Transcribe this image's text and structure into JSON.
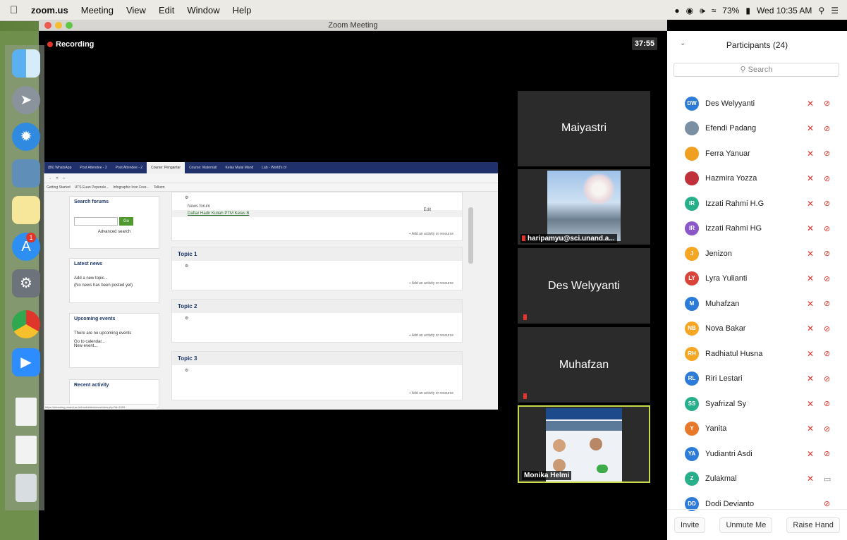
{
  "menubar": {
    "app_name": "zoom.us",
    "items": [
      "Meeting",
      "View",
      "Edit",
      "Window",
      "Help"
    ],
    "battery": "73%",
    "clock": "Wed 10:35 AM"
  },
  "window": {
    "title": "Zoom Meeting",
    "recording_label": "Recording",
    "timer": "37:55"
  },
  "shared_screen": {
    "tabs": [
      "(86) WhatsApp",
      "Post Attendee - 2",
      "Post Attendee - 2",
      "Course: Pengantar",
      "Course: Matemati",
      "Kelas Mulai Mand",
      "Lab - World's of"
    ],
    "active_tab_index": 3,
    "bookmarks": [
      "Getting Started",
      "UTS Euan Peperele...",
      "Infographic Icon Free...",
      "Telkom"
    ],
    "blocks": {
      "search_forums": {
        "title": "Search forums",
        "go": "Go",
        "advanced": "Advanced search"
      },
      "latest_news": {
        "title": "Latest news",
        "add": "Add a new topic...",
        "none": "(No news has been posted yet)"
      },
      "upcoming_events": {
        "title": "Upcoming events",
        "none": "There are no upcoming events",
        "go_calendar": "Go to calendar...",
        "new_event": "New event..."
      },
      "recent_activity": {
        "title": "Recent activity"
      }
    },
    "general": {
      "items": [
        "News forum",
        "Daftar Hadir Kuliah PTM Kelas B"
      ],
      "edit": "Edit",
      "add": "+ Add an activity or resource"
    },
    "topics": [
      {
        "title": "Topic 1",
        "add": "+ Add an activity or resource"
      },
      {
        "title": "Topic 2",
        "add": "+ Add an activity or resource"
      },
      {
        "title": "Topic 3",
        "add": "+ Add an activity or resource"
      }
    ],
    "status_url": "https://elearning.unand.ac.id/mod/attendance/view.php?id=1509"
  },
  "videos": [
    {
      "name": "Maiyastri",
      "muted": false
    },
    {
      "name": "haripamyu@sci.unand.a...",
      "muted": true
    },
    {
      "name": "Des Welyyanti",
      "muted": true
    },
    {
      "name": "Muhafzan",
      "muted": true
    },
    {
      "name": "Monika Helmi",
      "muted": false
    }
  ],
  "participants_panel": {
    "title": "Participants (24)",
    "search_placeholder": "Search",
    "participants": [
      {
        "name": "Des Welyyanti",
        "initials": "DW",
        "color": "#2d7bd9",
        "video": false
      },
      {
        "name": "Efendi Padang",
        "initials": "",
        "color": "#7b8fa3",
        "video": false
      },
      {
        "name": "Ferra Yanuar",
        "initials": "",
        "color": "#f0a020",
        "video": false
      },
      {
        "name": "Hazmira Yozza",
        "initials": "",
        "color": "#c0303a",
        "video": false
      },
      {
        "name": "Izzati Rahmi H.G",
        "initials": "IR",
        "color": "#27ae8a",
        "video": false
      },
      {
        "name": "Izzati Rahmi HG",
        "initials": "IR",
        "color": "#8a56c8",
        "video": false
      },
      {
        "name": "Jenizon",
        "initials": "J",
        "color": "#f5a623",
        "video": false
      },
      {
        "name": "Lyra Yulianti",
        "initials": "LY",
        "color": "#d9443a",
        "video": false
      },
      {
        "name": "Muhafzan",
        "initials": "M",
        "color": "#2d7bd9",
        "video": false
      },
      {
        "name": "Nova Bakar",
        "initials": "NB",
        "color": "#f5a623",
        "video": false
      },
      {
        "name": "Radhiatul Husna",
        "initials": "RH",
        "color": "#f5a623",
        "video": false
      },
      {
        "name": "Riri Lestari",
        "initials": "RL",
        "color": "#2d7bd9",
        "video": false
      },
      {
        "name": "Syafrizal Sy",
        "initials": "SS",
        "color": "#27ae8a",
        "video": false
      },
      {
        "name": "Yanita",
        "initials": "Y",
        "color": "#e8782a",
        "video": false
      },
      {
        "name": "Yudiantri Asdi",
        "initials": "YA",
        "color": "#2d7bd9",
        "video": false
      },
      {
        "name": "Zulakmal",
        "initials": "Z",
        "color": "#27ae8a",
        "video": true
      },
      {
        "name": "Dodi Devianto",
        "initials": "DD",
        "color": "#2d7bd9",
        "video": false
      }
    ],
    "buttons": {
      "invite": "Invite",
      "unmute": "Unmute Me",
      "raise_hand": "Raise Hand"
    }
  },
  "dock": {
    "apps": [
      "finder-icon",
      "launchpad-icon",
      "safari-icon",
      "preview-icon",
      "notes-icon",
      "app-store-icon",
      "system-preferences-icon",
      "chrome-icon",
      "zoom-icon",
      "document-icon",
      "document-icon",
      "trash-icon"
    ],
    "app_store_badge": "1"
  },
  "colors": {
    "muted_red": "#e0352b",
    "active_speaker_border": "#c8d94a",
    "moodle_title": "#1a3566"
  }
}
